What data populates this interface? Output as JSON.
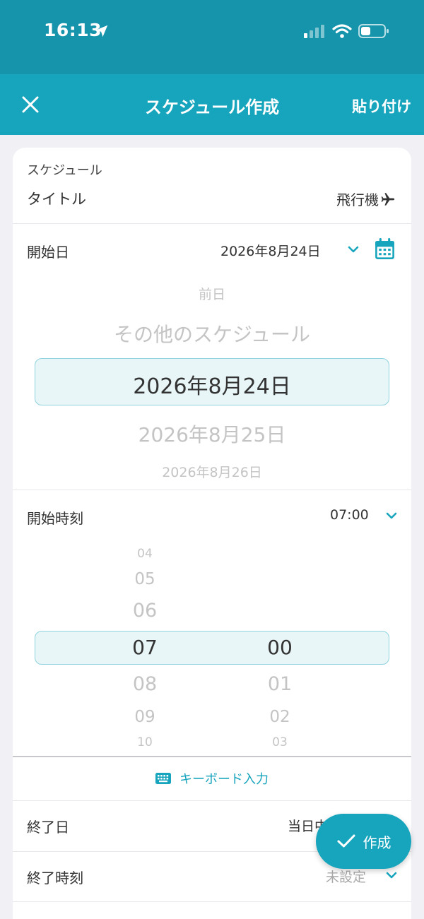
{
  "status": {
    "time": "16:13"
  },
  "nav": {
    "title": "スケジュール作成",
    "paste_label": "貼り付け"
  },
  "schedule": {
    "section_label": "スケジュール",
    "title_label": "タイトル",
    "title_value": "飛行機"
  },
  "start_date": {
    "label": "開始日",
    "value": "2026年8月24日",
    "picker": [
      "前日",
      "その他のスケジュール",
      "2026年8月24日",
      "2026年8月25日",
      "2026年8月26日"
    ]
  },
  "start_time": {
    "label": "開始時刻",
    "value": "07:00",
    "hours": [
      "04",
      "05",
      "06",
      "07",
      "08",
      "09",
      "10"
    ],
    "minutes": [
      "00",
      "01",
      "02",
      "03"
    ]
  },
  "keyboard_input_label": "キーボード入力",
  "end_date": {
    "label": "終了日",
    "value": "当日中"
  },
  "end_time": {
    "label": "終了時刻",
    "value": "未設定"
  },
  "fab": {
    "label": "作成"
  },
  "colors": {
    "accent": "#17a5bd",
    "header": "#1594ab"
  }
}
